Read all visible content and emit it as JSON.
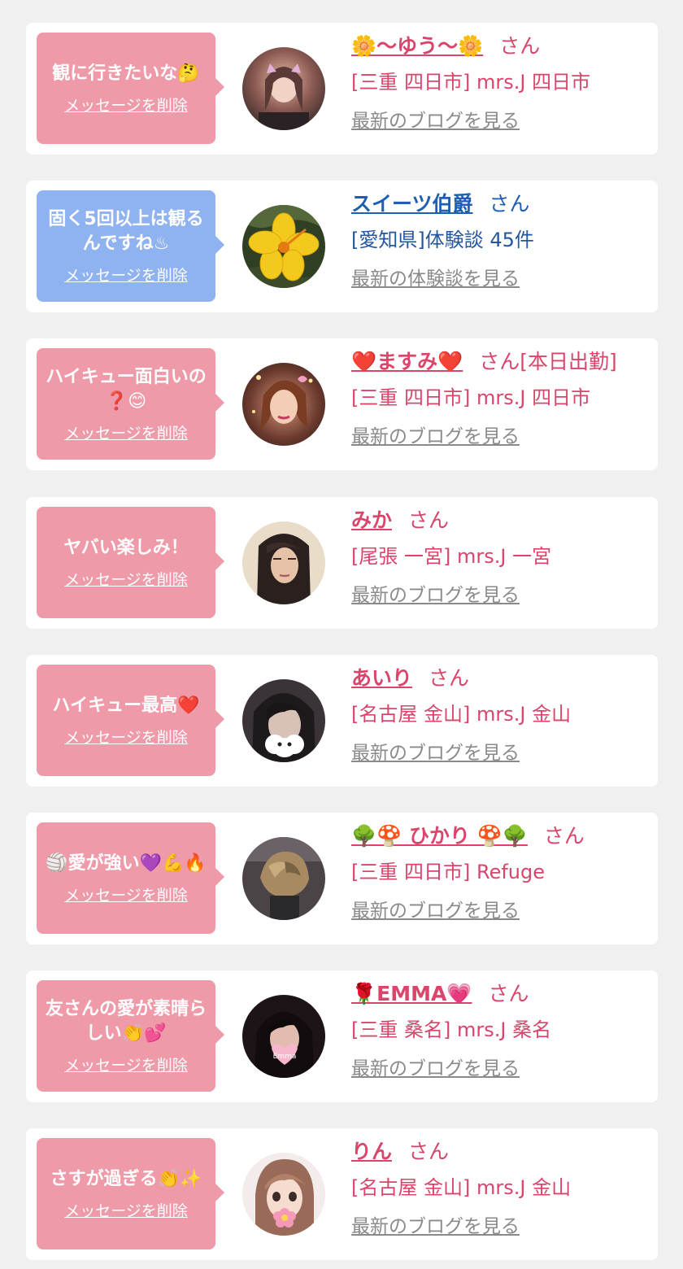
{
  "delete_label": "メッセージを削除",
  "colors": {
    "pink_bubble": "#ef9aa8",
    "blue_bubble": "#8fb2f0",
    "pink_text": "#d9456b",
    "blue_text": "#1e5fb4",
    "link_gray": "#8a8a8a"
  },
  "items": [
    {
      "message": "観に行きたいな🤔",
      "bubble_color": "pink",
      "name": "🌼〜ゆう〜🌼",
      "suffix": "さん",
      "location": "[三重 四日市] mrs.J 四日市",
      "link": "最新のブログを見る",
      "avatar_icon": "person-avatar"
    },
    {
      "message": "固く5回以上は観るんですね♨",
      "bubble_color": "blue",
      "name": "スイーツ伯爵",
      "suffix": "さん",
      "location": "[愛知県]体験談 45件",
      "link": "最新の体験談を見る",
      "avatar_icon": "flower-avatar"
    },
    {
      "message": "ハイキュー面白いの❓😊",
      "bubble_color": "pink",
      "name": "❤️ますみ❤️",
      "suffix": "さん[本日出勤]",
      "location": "[三重 四日市] mrs.J 四日市",
      "link": "最新のブログを見る",
      "avatar_icon": "person-avatar"
    },
    {
      "message": "ヤバい楽しみ！",
      "bubble_color": "pink",
      "name": "みか",
      "suffix": "さん",
      "location": "[尾張 一宮] mrs.J 一宮",
      "link": "最新のブログを見る",
      "avatar_icon": "person-avatar"
    },
    {
      "message": "ハイキュー最高❤️",
      "bubble_color": "pink",
      "name": "あいり",
      "suffix": "さん",
      "location": "[名古屋 金山] mrs.J 金山",
      "link": "最新のブログを見る",
      "avatar_icon": "person-avatar"
    },
    {
      "message": "🏐愛が強い💜💪🔥",
      "bubble_color": "pink",
      "name": "🌳🍄 ひかり 🍄🌳",
      "suffix": "さん",
      "location": "[三重 四日市] Refuge",
      "link": "最新のブログを見る",
      "avatar_icon": "person-avatar"
    },
    {
      "message": "友さんの愛が素晴らしい👏💕",
      "bubble_color": "pink",
      "name": "🌹EMMA💗",
      "suffix": "さん",
      "location": "[三重 桑名] mrs.J 桑名",
      "link": "最新のブログを見る",
      "avatar_icon": "person-avatar"
    },
    {
      "message": "さすが過ぎる👏✨",
      "bubble_color": "pink",
      "name": "りん",
      "suffix": "さん",
      "location": "[名古屋 金山] mrs.J 金山",
      "link": "最新のブログを見る",
      "avatar_icon": "person-avatar"
    }
  ]
}
